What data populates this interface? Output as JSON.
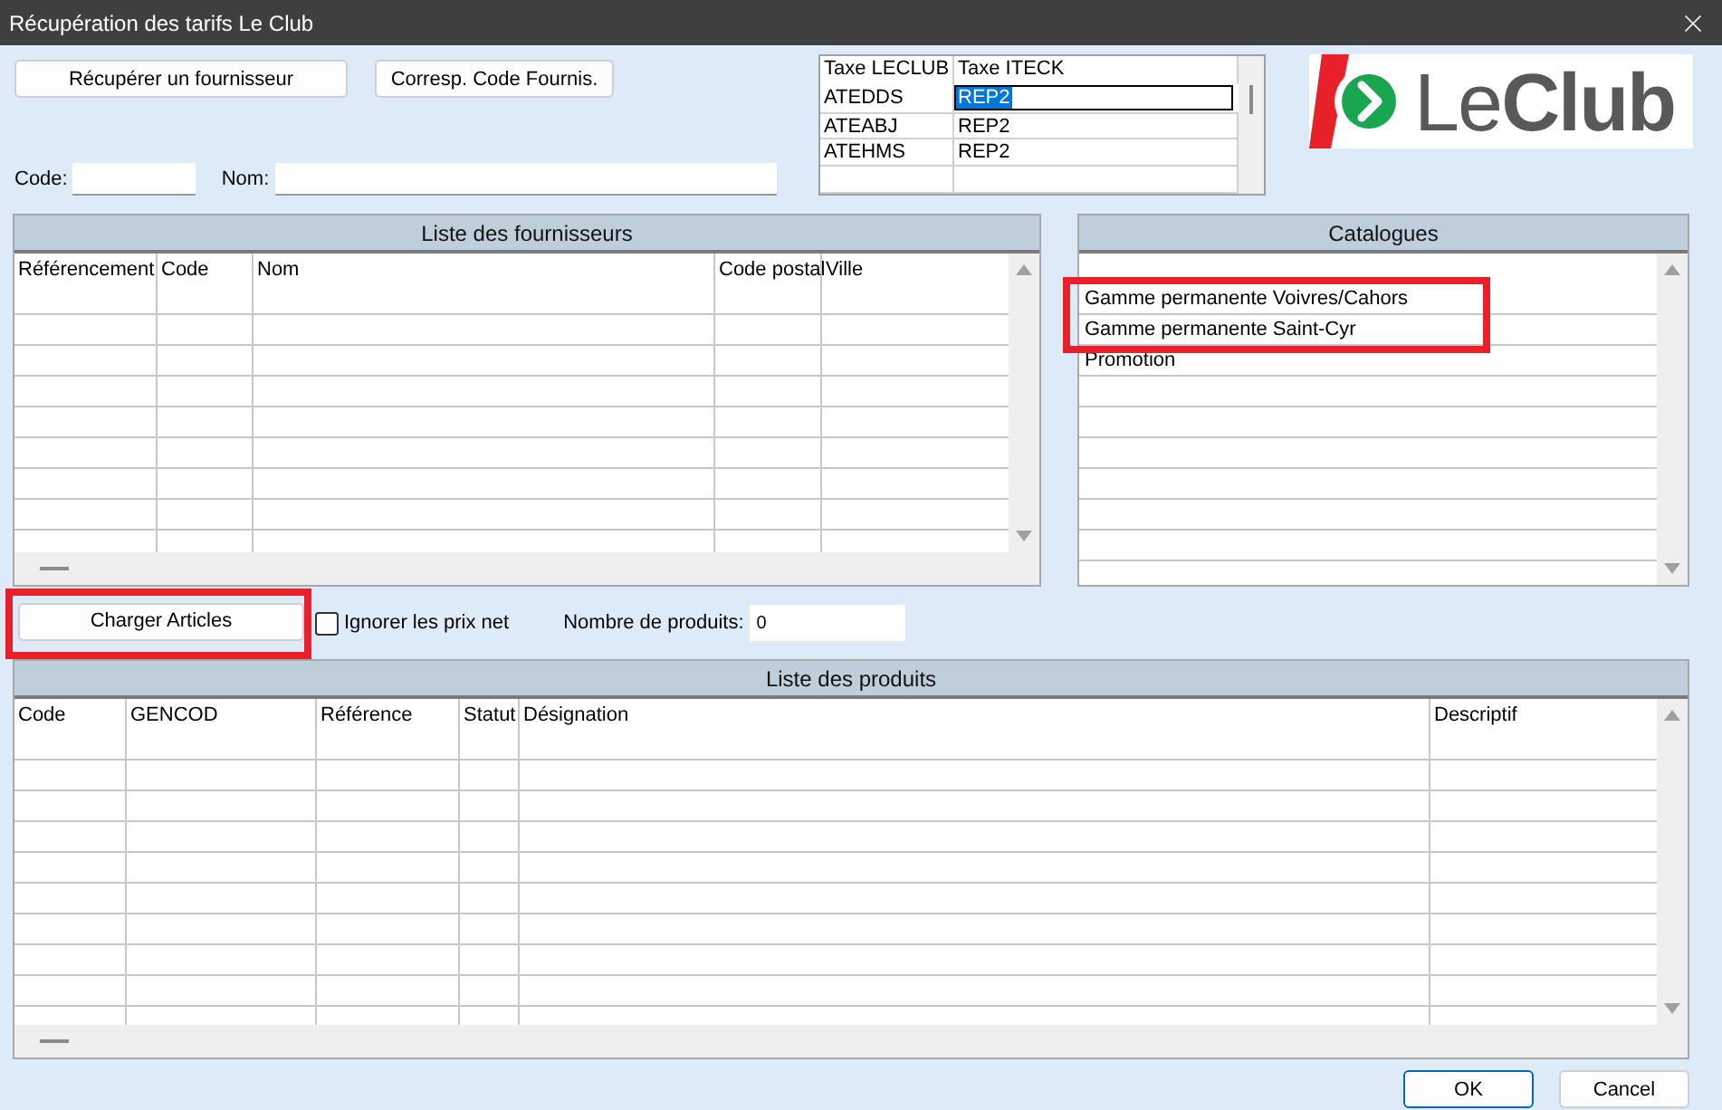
{
  "window": {
    "title": "Récupération des tarifs Le Club"
  },
  "top_buttons": [
    "Récupérer un fournisseur",
    "Corresp. Code Fournis."
  ],
  "filters": [
    {
      "label": "Code:"
    },
    {
      "label": "Nom:"
    }
  ],
  "tax_table": {
    "columns": [
      "Taxe LECLUB",
      "Taxe ITECK"
    ],
    "rows": [
      {
        "cells": [
          "ATEDDS",
          "REP2"
        ],
        "selected": true
      },
      {
        "cells": [
          "ATEABJ",
          "REP2"
        ],
        "selected": false
      },
      {
        "cells": [
          "ATEHMS",
          "REP2"
        ],
        "selected": false
      }
    ]
  },
  "logo": {
    "text_regular": "Le",
    "text_bold": "Club"
  },
  "suppliers": {
    "title": "Liste des fournisseurs",
    "columns": [
      "Référencement",
      "Code",
      "Nom",
      "Code postal",
      "Ville"
    ]
  },
  "catalogues": {
    "title": "Catalogues",
    "items": [
      {
        "label": "Gamme permanente Voivres/Cahors",
        "highlighted": true
      },
      {
        "label": "Gamme permanente Saint-Cyr",
        "highlighted": true
      },
      {
        "label": "Promotion",
        "highlighted": false
      }
    ]
  },
  "load_button": {
    "label": "Charger Articles",
    "highlighted": true
  },
  "ignore_net_prices": {
    "label": "Ignorer les prix net",
    "checked": false
  },
  "product_count": {
    "label": "Nombre de produits:",
    "value": "0"
  },
  "products": {
    "title": "Liste des produits",
    "columns": [
      "Code",
      "GENCOD",
      "Référence",
      "Statut",
      "Désignation",
      "Descriptif"
    ]
  },
  "footer_buttons": [
    {
      "label": "OK",
      "default": true
    },
    {
      "label": "Cancel",
      "default": false
    }
  ]
}
